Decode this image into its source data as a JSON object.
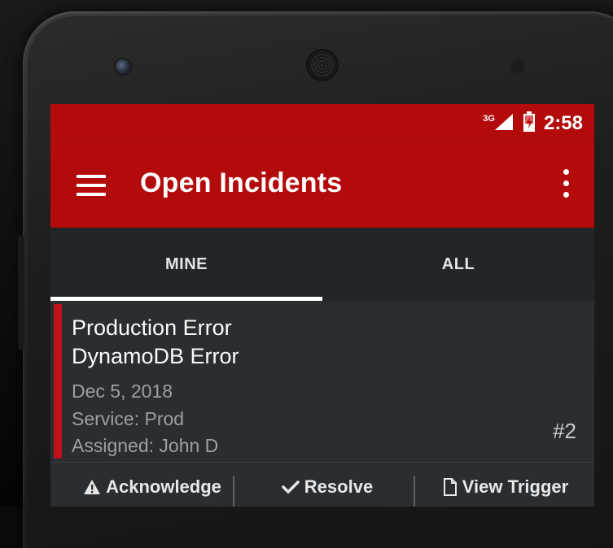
{
  "status_bar": {
    "network_label": "3G",
    "signal_icon": "signal-icon",
    "battery_icon": "battery-charging-icon",
    "time": "2:58"
  },
  "app_bar": {
    "menu_icon": "hamburger-menu-icon",
    "title": "Open Incidents",
    "overflow_icon": "more-vert-icon",
    "color": "#b30b0b"
  },
  "tabs": [
    {
      "label": "MINE",
      "selected": true
    },
    {
      "label": "ALL",
      "selected": false
    }
  ],
  "incidents": [
    {
      "title_line1": "Production Error",
      "title_line2": "DynamoDB Error",
      "date": "Dec 5, 2018",
      "service": "Service: Prod",
      "assigned": "Assigned: John D",
      "number": "#2",
      "accent_color": "#c0101a",
      "actions": [
        {
          "label": "Acknowledge",
          "icon": "warning-icon"
        },
        {
          "label": "Resolve",
          "icon": "check-icon"
        },
        {
          "label": "View Trigger",
          "icon": "document-icon"
        }
      ]
    }
  ]
}
